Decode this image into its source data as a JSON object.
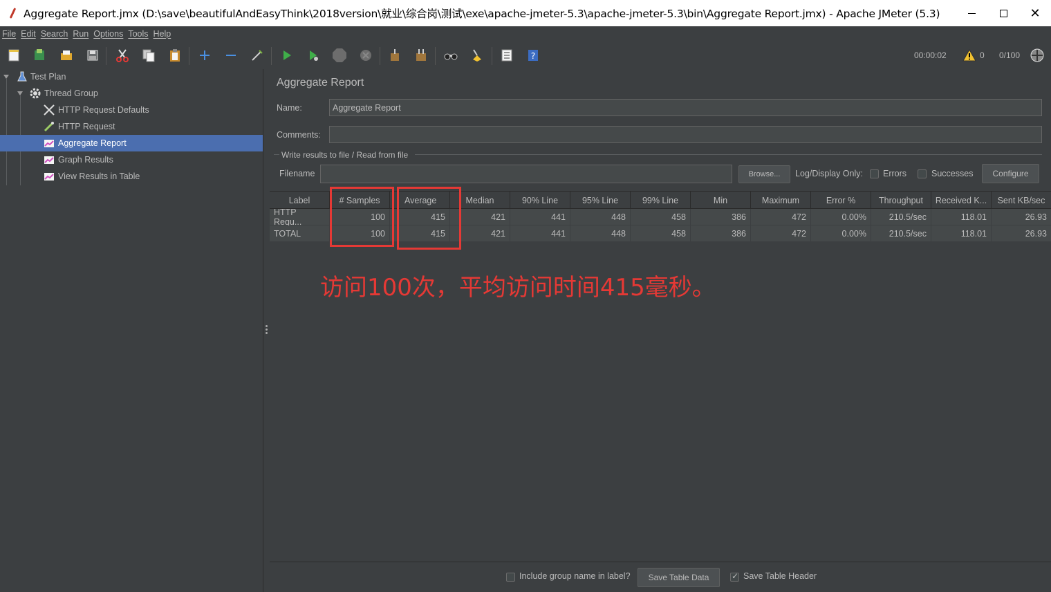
{
  "window": {
    "title": "Aggregate Report.jmx (D:\\save\\beautifulAndEasyThink\\2018version\\就业\\综合岗\\测试\\exe\\apache-jmeter-5.3\\apache-jmeter-5.3\\bin\\Aggregate Report.jmx) - Apache JMeter (5.3)"
  },
  "menu": [
    "File",
    "Edit",
    "Search",
    "Run",
    "Options",
    "Tools",
    "Help"
  ],
  "toolbar": {
    "timer": "00:00:02",
    "warning_count": "0",
    "threads": "0/100",
    "colors": {
      "accent": "#4b6eaf",
      "annotation": "#e53935"
    }
  },
  "tree": [
    {
      "label": "Test Plan",
      "icon": "flask-icon"
    },
    {
      "label": "Thread Group",
      "icon": "gear-icon"
    },
    {
      "label": "HTTP Request Defaults",
      "icon": "wrench-icon"
    },
    {
      "label": "HTTP Request",
      "icon": "pipette-icon"
    },
    {
      "label": "Aggregate Report",
      "icon": "chart-icon"
    },
    {
      "label": "Graph Results",
      "icon": "chart-icon"
    },
    {
      "label": "View Results in Table",
      "icon": "chart-icon"
    }
  ],
  "panel": {
    "title": "Aggregate Report",
    "name_label": "Name:",
    "name_value": "Aggregate Report",
    "comments_label": "Comments:",
    "comments_value": "",
    "section_title": "Write results to file / Read from file",
    "filename_label": "Filename",
    "filename_value": "",
    "browse_label": "Browse...",
    "log_display_label": "Log/Display Only:",
    "errors_label": "Errors",
    "successes_label": "Successes",
    "configure_label": "Configure"
  },
  "table": {
    "headers": [
      "Label",
      "# Samples",
      "Average",
      "Median",
      "90% Line",
      "95% Line",
      "99% Line",
      "Min",
      "Maximum",
      "Error %",
      "Throughput",
      "Received K...",
      "Sent KB/sec"
    ],
    "rows": [
      [
        "HTTP Requ...",
        "100",
        "415",
        "421",
        "441",
        "448",
        "458",
        "386",
        "472",
        "0.00%",
        "210.5/sec",
        "118.01",
        "26.93"
      ],
      [
        "TOTAL",
        "100",
        "415",
        "421",
        "441",
        "448",
        "458",
        "386",
        "472",
        "0.00%",
        "210.5/sec",
        "118.01",
        "26.93"
      ]
    ]
  },
  "annotation": "访问100次，平均访问时间415毫秒。",
  "bottom": {
    "include_group_label": "Include group name in label?",
    "save_table_data_label": "Save Table Data",
    "save_table_header_label": "Save Table Header"
  }
}
